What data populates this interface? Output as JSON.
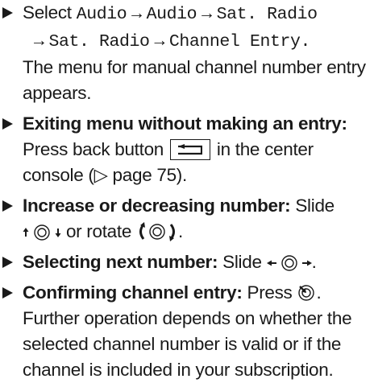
{
  "items": [
    {
      "select_word": "Select",
      "path": [
        "Audio",
        "Audio",
        "Sat. Radio",
        "Sat. Radio",
        "Channel Entry."
      ],
      "arrow": "→",
      "body": "The menu for manual channel number entry appears."
    },
    {
      "title": "Exiting menu without making an entry:",
      "text_before": "Press back button",
      "text_after": "in the center console (▷ page 75)."
    },
    {
      "title": "Increase or decreasing number:",
      "text_a": "Slide",
      "text_b": "or rotate",
      "text_c": "."
    },
    {
      "title": "Selecting next number:",
      "text_a": "Slide",
      "text_c": "."
    },
    {
      "title": "Confirming channel entry:",
      "text_a": "Press",
      "text_c": ".",
      "body": "Further operation depends on whether the selected channel number is valid or if the channel is included in your subscription."
    }
  ],
  "icons": [
    "back-button-icon",
    "slide-up-down-icon",
    "rotate-controller-icon",
    "slide-left-right-icon",
    "press-controller-icon"
  ]
}
